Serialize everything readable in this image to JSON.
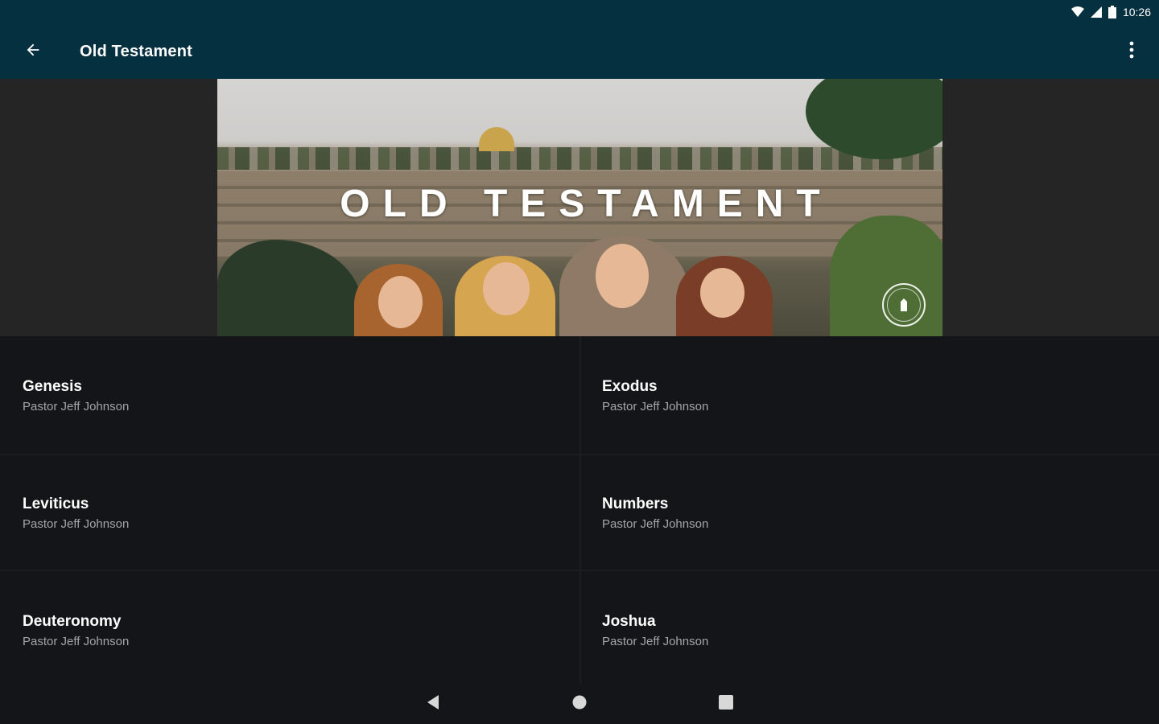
{
  "status_bar": {
    "time": "10:26"
  },
  "app_bar": {
    "title": "Old Testament"
  },
  "hero": {
    "title": "OLD TESTAMENT"
  },
  "items": [
    {
      "title": "Genesis",
      "subtitle": "Pastor Jeff Johnson"
    },
    {
      "title": "Exodus",
      "subtitle": "Pastor Jeff Johnson"
    },
    {
      "title": "Leviticus",
      "subtitle": "Pastor Jeff Johnson"
    },
    {
      "title": "Numbers",
      "subtitle": "Pastor Jeff Johnson"
    },
    {
      "title": "Deuteronomy",
      "subtitle": "Pastor Jeff Johnson"
    },
    {
      "title": "Joshua",
      "subtitle": "Pastor Jeff Johnson"
    }
  ],
  "colors": {
    "app_bar": "#05303f",
    "list_background": "#141518",
    "subtitle_text": "#a3a5a8"
  },
  "icons": {
    "back": "arrow-back-icon",
    "overflow": "more-vert-icon",
    "nav_back": "triangle-back-icon",
    "nav_home": "circle-home-icon",
    "nav_recents": "square-recents-icon"
  }
}
